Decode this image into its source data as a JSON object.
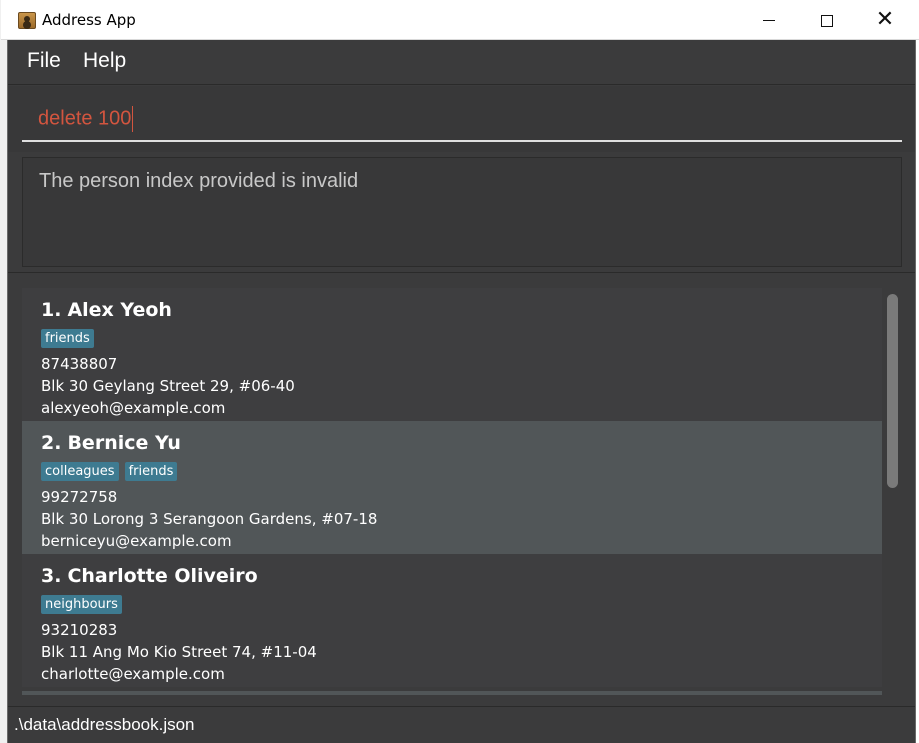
{
  "window": {
    "title": "Address App",
    "icon": "address-book-icon"
  },
  "menu": {
    "file_label": "File",
    "help_label": "Help"
  },
  "command": {
    "value": "delete 100"
  },
  "result": {
    "message": "The person index provided is invalid"
  },
  "persons": [
    {
      "index": "1.",
      "name": "Alex Yeoh",
      "tags": [
        "friends"
      ],
      "phone": "87438807",
      "address": "Blk 30 Geylang Street 29, #06-40",
      "email": "alexyeoh@example.com"
    },
    {
      "index": "2.",
      "name": "Bernice Yu",
      "tags": [
        "colleagues",
        "friends"
      ],
      "phone": "99272758",
      "address": "Blk 30 Lorong 3 Serangoon Gardens, #07-18",
      "email": "berniceyu@example.com"
    },
    {
      "index": "3.",
      "name": "Charlotte Oliveiro",
      "tags": [
        "neighbours"
      ],
      "phone": "93210283",
      "address": "Blk 11 Ang Mo Kio Street 74, #11-04",
      "email": "charlotte@example.com"
    }
  ],
  "status": {
    "save_location": ".\\data\\addressbook.json"
  },
  "colors": {
    "background": "#3b3b3c",
    "card_odd": "#3e3e40",
    "card_even": "#515658",
    "tag": "#3e7b91",
    "command_error_text": "#d2553f"
  }
}
